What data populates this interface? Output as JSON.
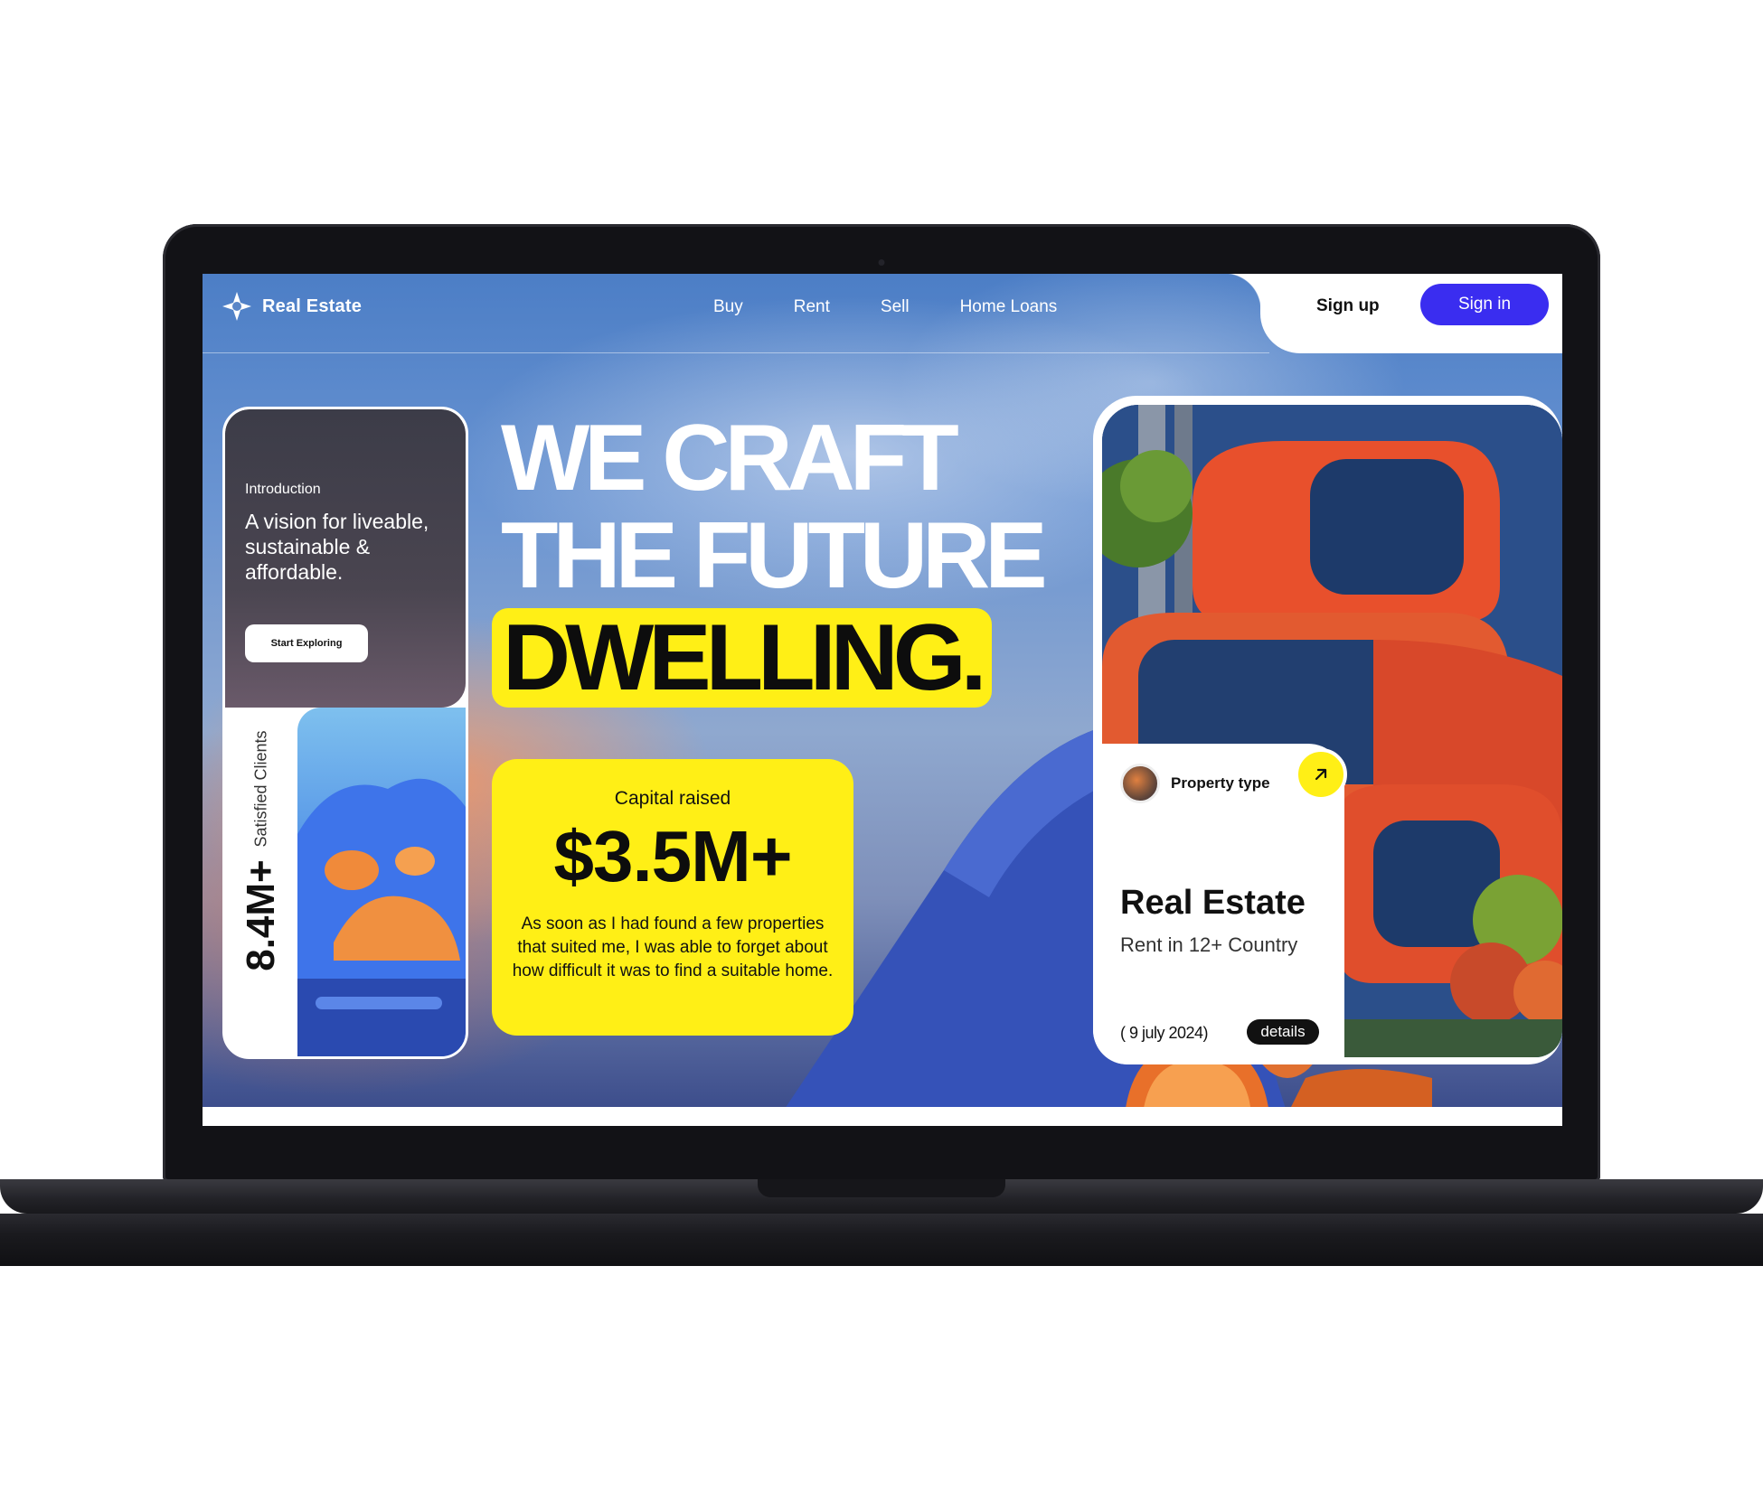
{
  "nav": {
    "logo_text": "Real Estate",
    "links": [
      "Buy",
      "Rent",
      "Sell",
      "Home Loans"
    ],
    "sign_up": "Sign up",
    "sign_in": "Sign in"
  },
  "intro_card": {
    "label": "Introduction",
    "heading": "A vision for liveable, sustainable & affordable.",
    "cta": "Start Exploring",
    "clients_count": "8.4M+",
    "clients_label": "Satisfied Clients"
  },
  "headline": {
    "line1": "WE CRAFT",
    "line2": "THE FUTURE",
    "highlight": "DWELLING."
  },
  "capital_card": {
    "label": "Capital raised",
    "value": "$3.5M+",
    "quote": "As soon as I had found a few properties that suited me, I was able to forget about how difficult it was to find a suitable home."
  },
  "property_card": {
    "type_label": "Property type",
    "title": "Real Estate",
    "subtitle": "Rent in 12+ Country",
    "date": "( 9 july 2024)",
    "details": "details"
  },
  "colors": {
    "accent_yellow": "#ffef16",
    "primary_button": "#3a2df0",
    "device_frame": "#121216"
  },
  "icons": [
    "diamond-logo-icon",
    "arrow-up-right-icon"
  ]
}
